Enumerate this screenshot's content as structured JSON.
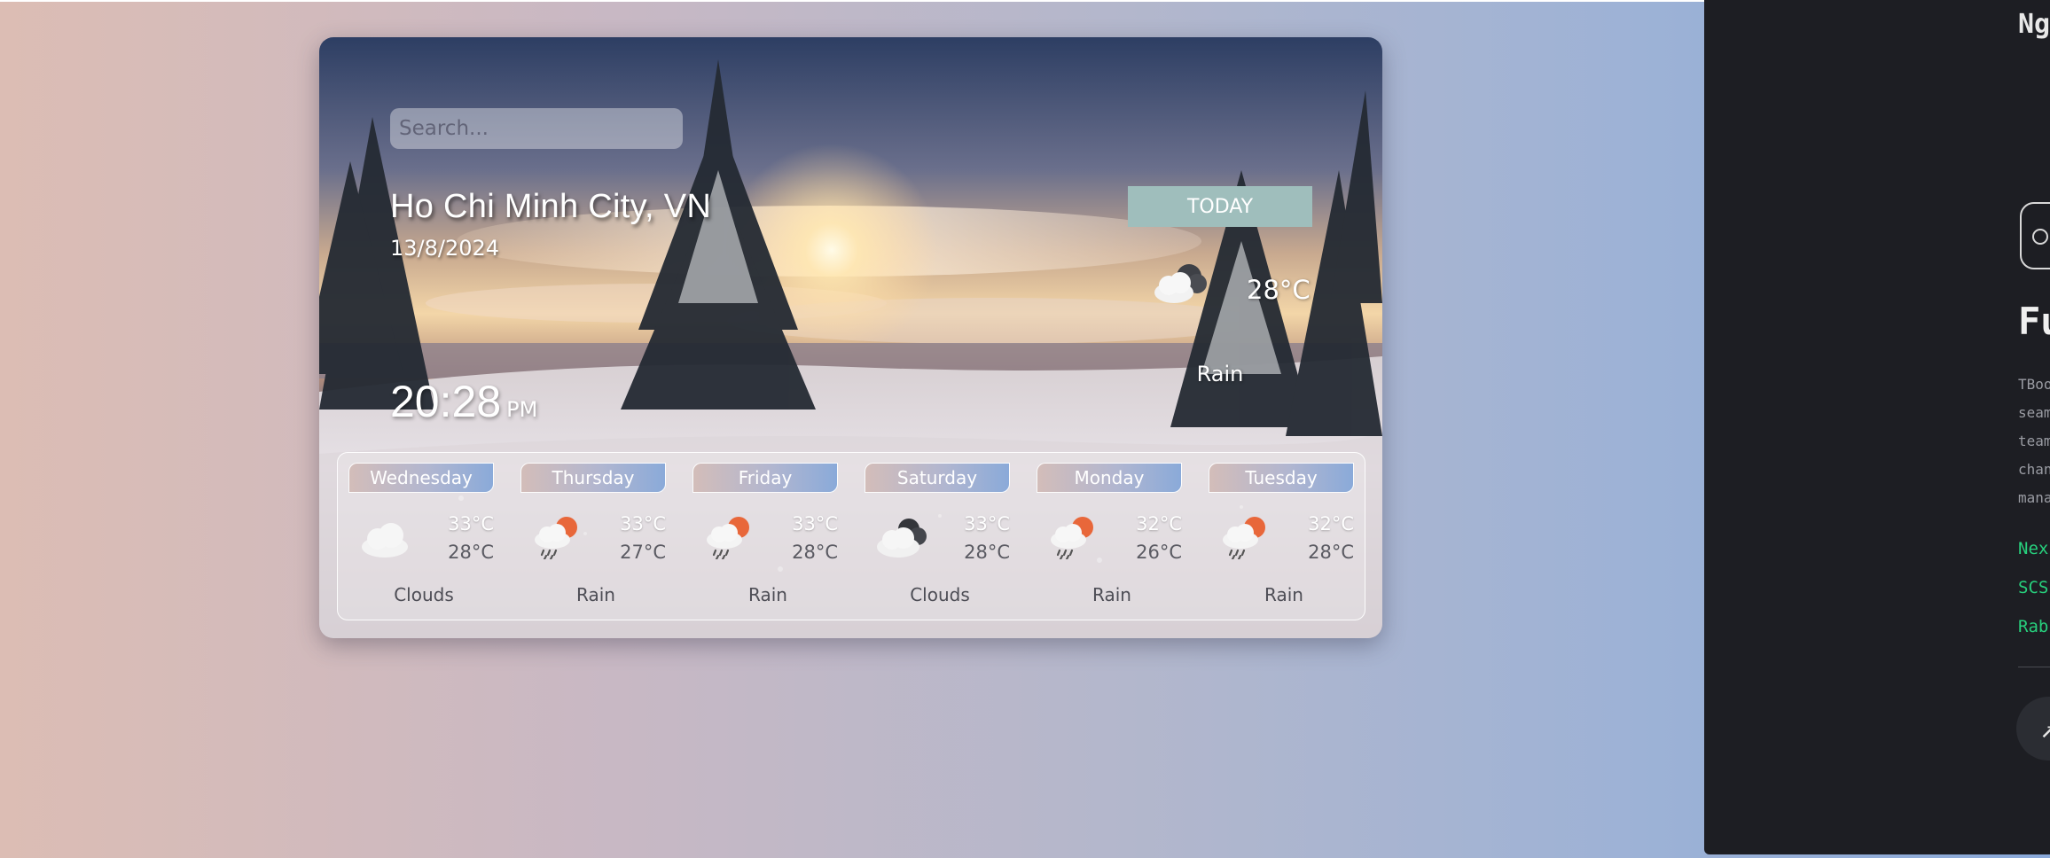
{
  "search": {
    "placeholder": "Search..."
  },
  "location": {
    "city": "Ho Chi Minh City, VN",
    "date": "13/8/2024"
  },
  "clock": {
    "time": "20:28",
    "ampm": "PM"
  },
  "today": {
    "label": "TODAY",
    "temp": "28°C",
    "condition": "Rain",
    "icon": "cloud-dark-icon"
  },
  "forecast": [
    {
      "day": "Wednesday",
      "max": "33°C",
      "min": "28°C",
      "condition": "Clouds",
      "icon": "cloud-icon"
    },
    {
      "day": "Thursday",
      "max": "33°C",
      "min": "27°C",
      "condition": "Rain",
      "icon": "sun-rain-icon"
    },
    {
      "day": "Friday",
      "max": "33°C",
      "min": "28°C",
      "condition": "Rain",
      "icon": "sun-rain-icon"
    },
    {
      "day": "Saturday",
      "max": "33°C",
      "min": "28°C",
      "condition": "Clouds",
      "icon": "dark-clouds-icon"
    },
    {
      "day": "Monday",
      "max": "32°C",
      "min": "26°C",
      "condition": "Rain",
      "icon": "sun-rain-icon"
    },
    {
      "day": "Tuesday",
      "max": "32°C",
      "min": "28°C",
      "condition": "Rain",
      "icon": "sun-rain-icon"
    }
  ],
  "panel": {
    "name": "Ng",
    "title": "Fu",
    "description": [
      "TBoo",
      "seam",
      "team",
      "chan",
      "mana"
    ],
    "tags": [
      "Nex",
      "SCS",
      "Rab"
    ],
    "arrow": "↗"
  },
  "colors": {
    "today_tab": "#9fbebc",
    "panel_bg": "#1d1e23",
    "tag_green": "#27d07d",
    "sun_orange": "#e8673a"
  }
}
